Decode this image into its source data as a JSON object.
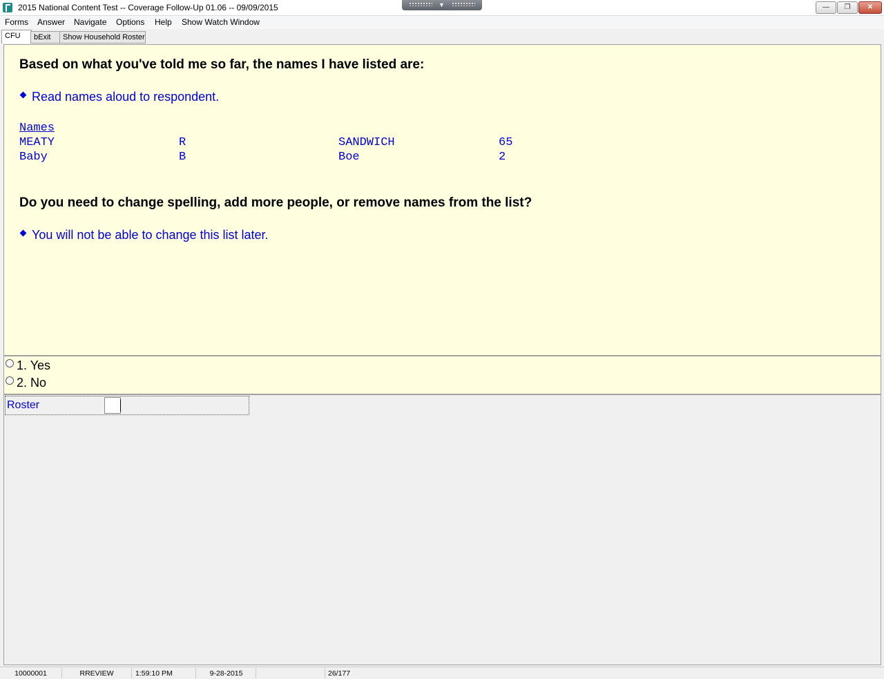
{
  "window": {
    "title": "2015 National Content Test -- Coverage Follow-Up 01.06 -- 09/09/2015",
    "icons": {
      "app": "app-icon",
      "grip_arrow": "down-arrow-icon",
      "minimize": "minimize-icon",
      "restore": "restore-icon",
      "close": "close-icon"
    },
    "buttons": {
      "minimize": "—",
      "restore": "❐",
      "close": "✕"
    },
    "grip_arrow": "▼"
  },
  "menu": [
    "Forms",
    "Answer",
    "Navigate",
    "Options",
    "Help",
    "Show Watch Window"
  ],
  "tabs": [
    "CFU",
    "bExit",
    "Show Household Roster"
  ],
  "question": {
    "heading": "Based on what you've told me so far, the names I have listed are:",
    "instruction": "Read names aloud to respondent.",
    "names_header": "Names",
    "names": [
      {
        "first": "MEATY",
        "middle": "R",
        "last": "SANDWICH",
        "age": "65"
      },
      {
        "first": "Baby",
        "middle": "B",
        "last": "Boe",
        "age": "2"
      }
    ],
    "followup": "Do you need to change spelling, add more people, or remove names from the list?",
    "followup_instruction": "You will not be able to change this list later."
  },
  "answers": [
    "1. Yes",
    "2. No"
  ],
  "roster": {
    "label": "Roster",
    "value": ""
  },
  "status": {
    "case_id": "10000001",
    "mode": "RREVIEW",
    "time": "1:59:10 PM",
    "date": "9-28-2015",
    "blank": "",
    "progress": "26/177"
  },
  "colors": {
    "question_bg": "#ffffe0",
    "instruction_text": "#0000d8",
    "window_bg": "#f0f0f0"
  }
}
